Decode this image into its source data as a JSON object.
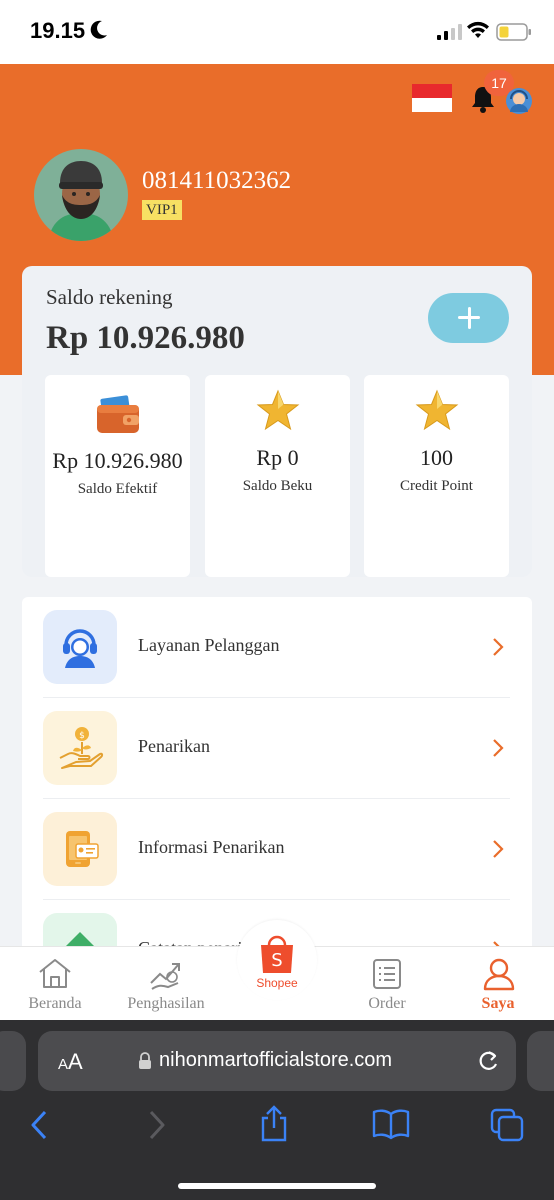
{
  "status_bar": {
    "time": "19.15"
  },
  "header": {
    "notification_count": "17",
    "phone": "081411032362",
    "vip_level": "VIP1"
  },
  "balance": {
    "label": "Saldo rekening",
    "amount": "Rp 10.926.980",
    "stats": [
      {
        "value": "Rp 10.926.980",
        "label": "Saldo Efektif",
        "icon": "wallet-icon"
      },
      {
        "value": "Rp 0",
        "label": "Saldo Beku",
        "icon": "star-icon"
      },
      {
        "value": "100",
        "label": "Credit Point",
        "icon": "star-icon"
      }
    ]
  },
  "menu": {
    "items": [
      {
        "label": "Layanan Pelanggan",
        "icon": "customer-service-icon"
      },
      {
        "label": "Penarikan",
        "icon": "withdraw-coin-hand-icon"
      },
      {
        "label": "Informasi Penarikan",
        "icon": "phone-card-icon"
      },
      {
        "label": "Catatan penarikan",
        "icon": "arrow-up-chart-icon"
      }
    ]
  },
  "bottom_nav": {
    "items": [
      {
        "label": "Beranda",
        "icon": "home-icon"
      },
      {
        "label": "Penghasilan",
        "icon": "income-icon"
      },
      {
        "label": "Shopee",
        "icon": "shopee-bag-icon"
      },
      {
        "label": "Order",
        "icon": "order-list-icon"
      },
      {
        "label": "Saya",
        "icon": "user-icon"
      }
    ],
    "active": "Saya"
  },
  "browser": {
    "aa_small": "A",
    "aa_large": "A",
    "url": "nihonmartofficialstore.com"
  },
  "colors": {
    "brand_orange": "#e96d2a",
    "accent_blue": "#7ecbe0",
    "vip_yellow": "#f7e063",
    "shopee_red": "#ee4d2d"
  }
}
